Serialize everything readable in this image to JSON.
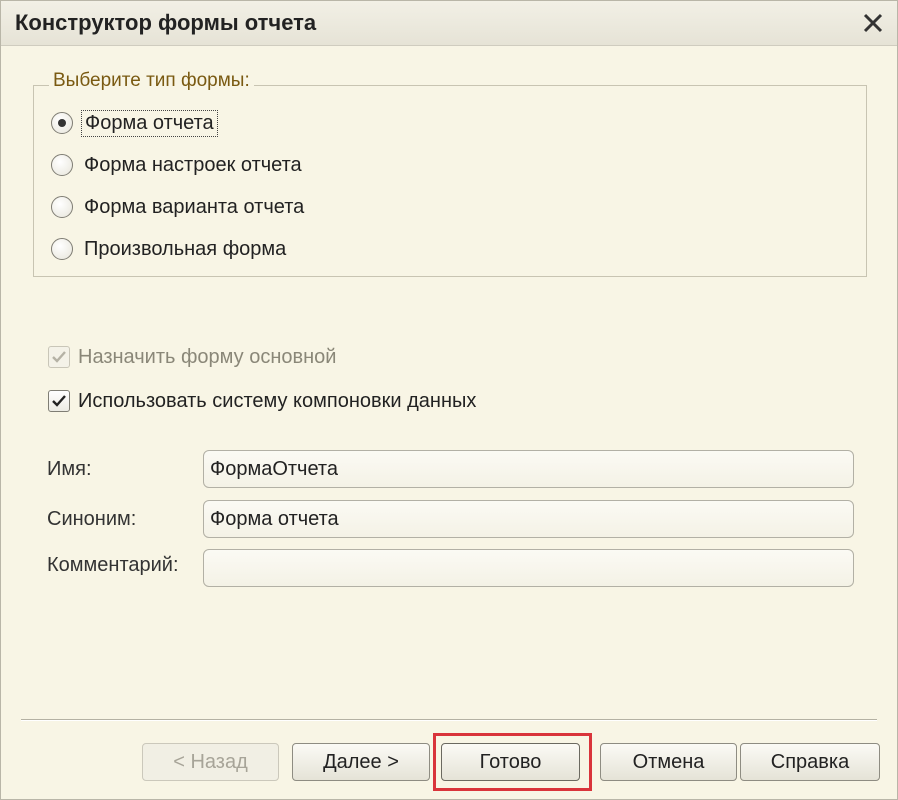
{
  "window": {
    "title": "Конструктор формы отчета",
    "close_icon": "close-icon"
  },
  "form_type": {
    "legend": "Выберите тип формы:",
    "options": [
      {
        "label": "Форма отчета",
        "checked": true
      },
      {
        "label": "Форма настроек отчета",
        "checked": false
      },
      {
        "label": "Форма варианта отчета",
        "checked": false
      },
      {
        "label": "Произвольная форма",
        "checked": false
      }
    ]
  },
  "options": {
    "set_main": {
      "label": "Назначить форму основной",
      "checked": true,
      "enabled": false
    },
    "use_dcs": {
      "label": "Использовать систему компоновки данных",
      "checked": true,
      "enabled": true
    }
  },
  "fields": {
    "name": {
      "label": "Имя:",
      "value": "ФормаОтчета"
    },
    "synonym": {
      "label": "Синоним:",
      "value": "Форма отчета"
    },
    "comment": {
      "label": "Комментарий:",
      "value": ""
    }
  },
  "buttons": {
    "back": "< Назад",
    "next": "Далее >",
    "done": "Готово",
    "cancel": "Отмена",
    "help": "Справка"
  },
  "colors": {
    "highlight": "#d9343b",
    "background": "#f8f5e5",
    "legend_text": "#7a5a12"
  }
}
